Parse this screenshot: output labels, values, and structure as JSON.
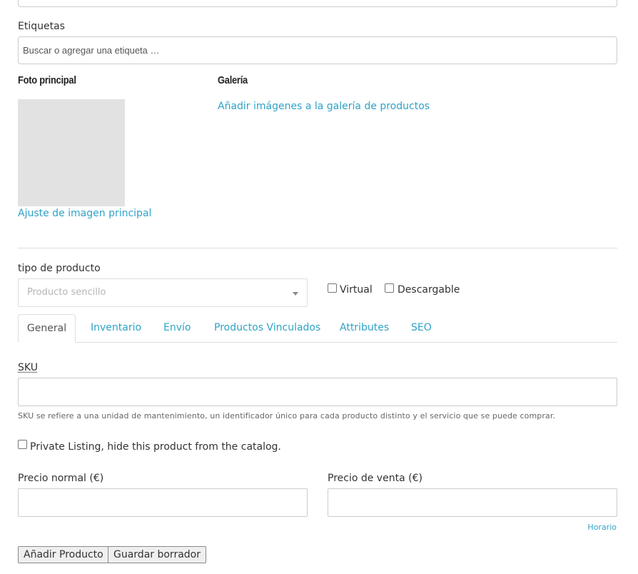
{
  "tags": {
    "label": "Etiquetas",
    "placeholder": "Buscar o agregar una etiqueta …"
  },
  "featured_image": {
    "heading": "Foto principal",
    "set_link": "Ajuste de imagen principal"
  },
  "gallery": {
    "heading": "Galería",
    "add_link": "Añadir imágenes a la galería de productos"
  },
  "product_type": {
    "label": "tipo de producto",
    "selected": "Producto sencillo",
    "virtual_label": "Virtual",
    "downloadable_label": "Descargable"
  },
  "tabs": [
    {
      "label": "General"
    },
    {
      "label": "Inventario"
    },
    {
      "label": "Envío"
    },
    {
      "label": "Productos Vinculados"
    },
    {
      "label": "Attributes"
    },
    {
      "label": "SEO"
    }
  ],
  "general": {
    "sku_label": "SKU",
    "sku_value": "",
    "sku_help": "SKU se refiere a una unidad de mantenimiento, un identificador único para cada producto distinto y el servicio que se puede comprar.",
    "private_listing_label": "Private Listing, hide this product from the catalog.",
    "regular_price_label": "Precio normal (€)",
    "sale_price_label": "Precio de venta (€)",
    "schedule_link": "Horario"
  },
  "actions": {
    "add_product": "Añadir Producto",
    "save_draft": "Guardar borrador"
  },
  "colors": {
    "link": "#2ea3c7",
    "border": "#cccccc",
    "placeholder_bg": "#e2e2e2"
  }
}
